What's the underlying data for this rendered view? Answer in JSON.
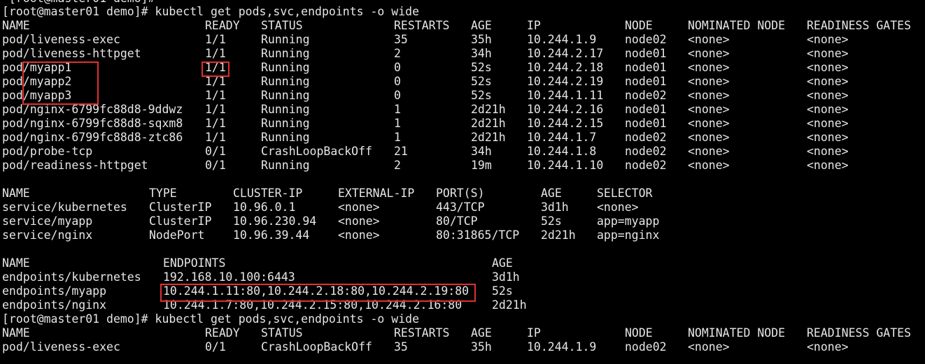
{
  "top_partial_line": "~[root@master01 demo]#",
  "prompts": [
    {
      "text": "[root@master01 demo]# kubectl get pods,svc,endpoints -o wide"
    },
    {
      "text": "[root@master01 demo]# kubectl get pods,svc,endpoints -o wide"
    }
  ],
  "pods": {
    "headers": [
      "NAME",
      "READY",
      "STATUS",
      "RESTARTS",
      "AGE",
      "IP",
      "NODE",
      "NOMINATED NODE",
      "READINESS GATES"
    ],
    "rows": [
      [
        "pod/liveness-exec",
        "1/1",
        "Running",
        "35",
        "35h",
        "10.244.1.9",
        "node02",
        "<none>",
        "<none>"
      ],
      [
        "pod/liveness-httpget",
        "1/1",
        "Running",
        "2",
        "34h",
        "10.244.2.17",
        "node01",
        "<none>",
        "<none>"
      ],
      [
        "pod/myapp1",
        "1/1",
        "Running",
        "0",
        "52s",
        "10.244.2.18",
        "node01",
        "<none>",
        "<none>"
      ],
      [
        "pod/myapp2",
        "1/1",
        "Running",
        "0",
        "52s",
        "10.244.2.19",
        "node01",
        "<none>",
        "<none>"
      ],
      [
        "pod/myapp3",
        "1/1",
        "Running",
        "0",
        "52s",
        "10.244.1.11",
        "node02",
        "<none>",
        "<none>"
      ],
      [
        "pod/nginx-6799fc88d8-9ddwz",
        "1/1",
        "Running",
        "1",
        "2d21h",
        "10.244.2.16",
        "node01",
        "<none>",
        "<none>"
      ],
      [
        "pod/nginx-6799fc88d8-sqxm8",
        "1/1",
        "Running",
        "1",
        "2d21h",
        "10.244.2.15",
        "node01",
        "<none>",
        "<none>"
      ],
      [
        "pod/nginx-6799fc88d8-ztc86",
        "1/1",
        "Running",
        "1",
        "2d21h",
        "10.244.1.7",
        "node02",
        "<none>",
        "<none>"
      ],
      [
        "pod/probe-tcp",
        "0/1",
        "CrashLoopBackOff",
        "21",
        "34h",
        "10.244.1.8",
        "node02",
        "<none>",
        "<none>"
      ],
      [
        "pod/readiness-httpget",
        "0/1",
        "Running",
        "2",
        "19m",
        "10.244.1.10",
        "node02",
        "<none>",
        "<none>"
      ]
    ]
  },
  "services": {
    "headers": [
      "NAME",
      "TYPE",
      "CLUSTER-IP",
      "EXTERNAL-IP",
      "PORT(S)",
      "AGE",
      "SELECTOR"
    ],
    "rows": [
      [
        "service/kubernetes",
        "ClusterIP",
        "10.96.0.1",
        "<none>",
        "443/TCP",
        "3d1h",
        "<none>"
      ],
      [
        "service/myapp",
        "ClusterIP",
        "10.96.230.94",
        "<none>",
        "80/TCP",
        "52s",
        "app=myapp"
      ],
      [
        "service/nginx",
        "NodePort",
        "10.96.39.44",
        "<none>",
        "80:31865/TCP",
        "2d21h",
        "app=nginx"
      ]
    ]
  },
  "endpoints": {
    "headers": [
      "NAME",
      "ENDPOINTS",
      "AGE"
    ],
    "rows": [
      [
        "endpoints/kubernetes",
        "192.168.10.100:6443",
        "3d1h"
      ],
      [
        "endpoints/myapp",
        "10.244.1.11:80,10.244.2.18:80,10.244.2.19:80",
        "52s"
      ],
      [
        "endpoints/nginx",
        "10.244.1.7:80,10.244.2.15:80,10.244.2.16:80",
        "2d21h"
      ]
    ]
  },
  "pods2": {
    "headers": [
      "NAME",
      "READY",
      "STATUS",
      "RESTARTS",
      "AGE",
      "IP",
      "NODE",
      "NOMINATED NODE",
      "READINESS GATES"
    ],
    "rows": [
      [
        "pod/liveness-exec",
        "0/1",
        "CrashLoopBackOff",
        "35",
        "35h",
        "10.244.1.9",
        "node02",
        "<none>",
        "<none>"
      ]
    ]
  },
  "colors": {
    "background": "#000000",
    "text": "#e6e6e6",
    "highlight": "#e03030"
  }
}
